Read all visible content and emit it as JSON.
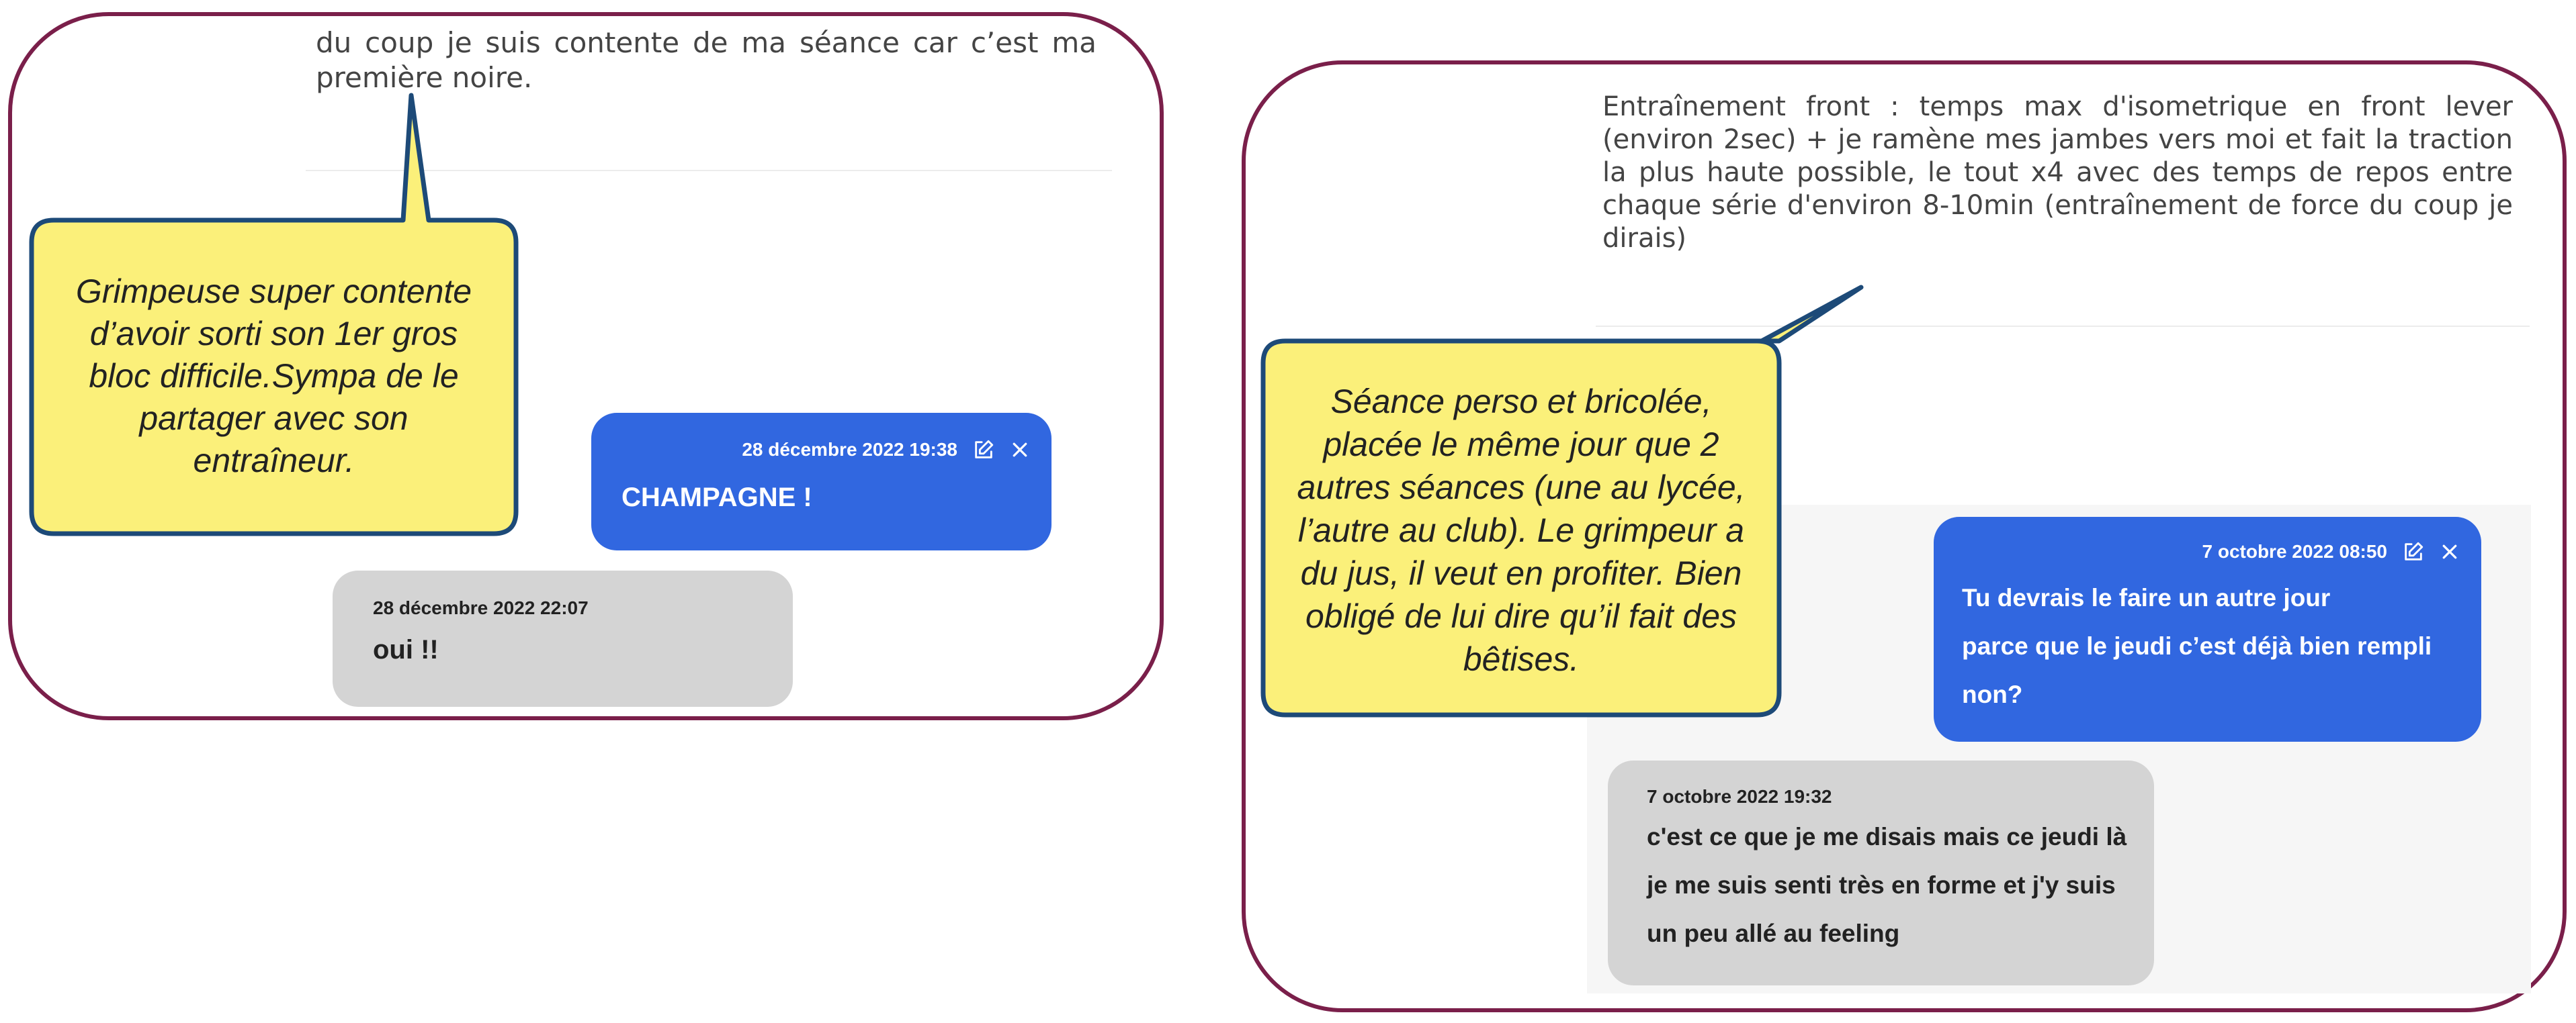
{
  "left_panel": {
    "post_text": "du coup je suis contente de ma séance car c’est ma première noire.",
    "messages": [
      {
        "type": "coach",
        "timestamp": "28 décembre 2022 19:38",
        "text": "CHAMPAGNE !",
        "icons": [
          "edit-icon",
          "close-icon"
        ]
      },
      {
        "type": "athlete",
        "timestamp": "28 décembre 2022 22:07",
        "text": "oui !!"
      }
    ],
    "callout": "Grimpeuse super contente d’avoir sorti son 1er gros bloc difficile.Sympa de le partager avec son entraîneur."
  },
  "right_panel": {
    "post_text": "Entraînement front : temps max d'isometrique en front lever (environ 2sec) + je ramène mes jambes vers moi et fait la traction la plus haute possible, le tout x4 avec des temps de repos entre chaque série d'environ 8-10min (entraînement de force du coup je dirais)",
    "messages": [
      {
        "type": "coach",
        "timestamp": "7 octobre 2022 08:50",
        "text": "Tu devrais le faire un autre jour\nparce que le jeudi c’est déjà bien rempli\nnon?",
        "icons": [
          "edit-icon",
          "close-icon"
        ]
      },
      {
        "type": "athlete",
        "timestamp": "7 octobre 2022 19:32",
        "text": "c'est ce que je me disais mais ce jeudi là\nje me suis senti très en forme et j'y suis\nun peu allé au feeling"
      }
    ],
    "callout": "Séance perso et bricolée, placée le même jour que 2 autres séances (une au lycée, l’autre au club). Le grimpeur a du jus, il veut en profiter. Bien obligé de lui dire qu’il fait des bêtises."
  },
  "colors": {
    "frame_border": "#7a1f4a",
    "coach_bubble": "#3167e0",
    "athlete_bubble": "#d4d4d4",
    "callout_fill": "#fbf07a",
    "callout_border": "#1d4a78"
  }
}
